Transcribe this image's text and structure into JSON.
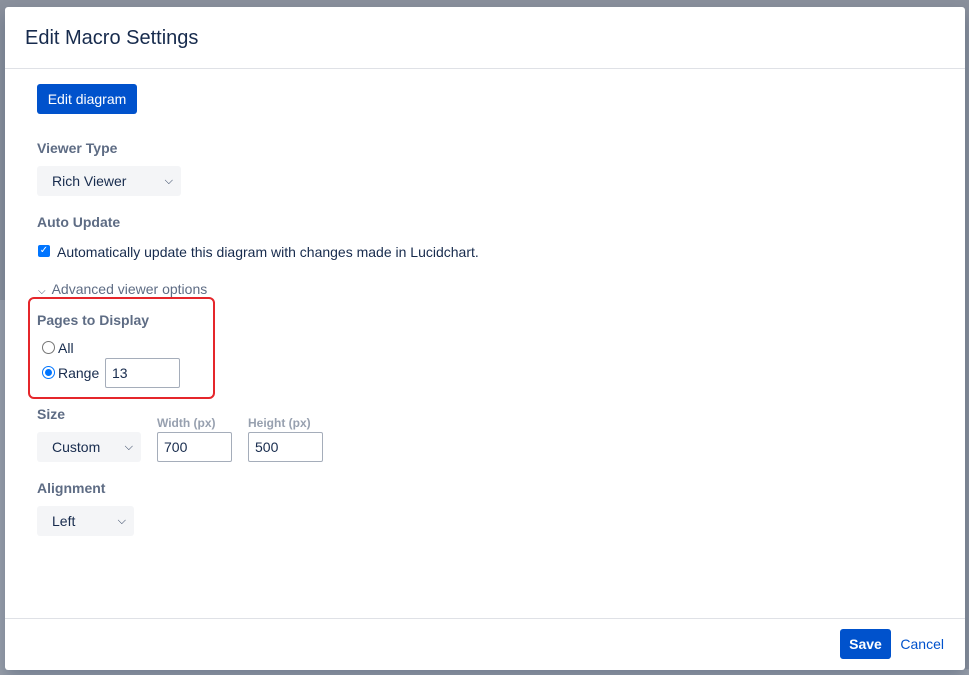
{
  "dialog": {
    "title": "Edit Macro Settings",
    "edit_diagram_label": "Edit diagram"
  },
  "viewer_type": {
    "label": "Viewer Type",
    "selected": "Rich Viewer"
  },
  "auto_update": {
    "label": "Auto Update",
    "checked": true,
    "checkbox_label": "Automatically update this diagram with changes made in Lucidchart."
  },
  "advanced": {
    "toggle_label": "Advanced viewer options"
  },
  "pages_to_display": {
    "label": "Pages to Display",
    "options": [
      {
        "label": "All",
        "checked": false
      },
      {
        "label": "Range",
        "checked": true
      }
    ],
    "range_value": "13"
  },
  "size": {
    "label": "Size",
    "selected": "Custom",
    "width_label": "Width (px)",
    "width_value": "700",
    "height_label": "Height (px)",
    "height_value": "500"
  },
  "alignment": {
    "label": "Alignment",
    "selected": "Left"
  },
  "footer": {
    "save_label": "Save",
    "cancel_label": "Cancel"
  },
  "colors": {
    "primary": "#0052cc",
    "highlight": "#e5262b",
    "checkbox": "#0075ff"
  }
}
